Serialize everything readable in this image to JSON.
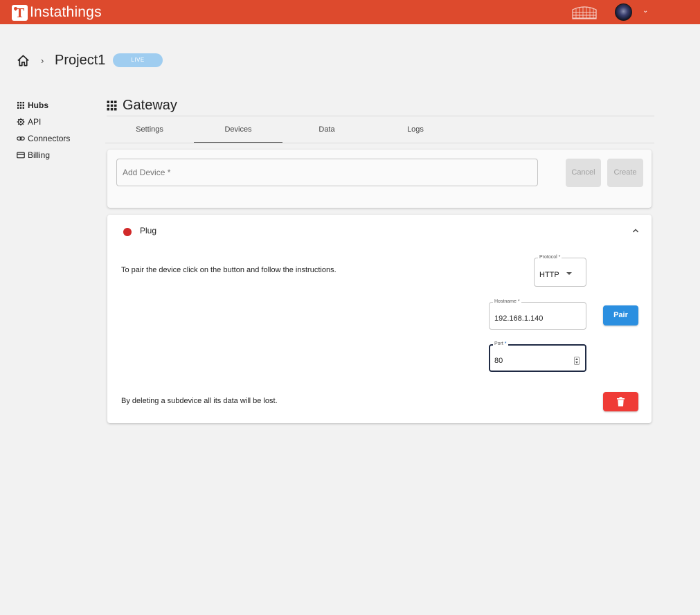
{
  "app": {
    "name": "Instathings",
    "logo_letter": "T"
  },
  "header": {
    "logo_icon": "instathings-logo-icon",
    "partner_icon": "colosseum-icon",
    "avatar_icon": "user-avatar",
    "menu_icon": "chevron-down-icon"
  },
  "breadcrumb": {
    "home_icon": "home-icon",
    "separator": "›",
    "project": "Project1",
    "badge": "LIVE"
  },
  "sidebar": {
    "items": [
      {
        "label": "Hubs",
        "icon": "grid-icon",
        "active": true
      },
      {
        "label": "API",
        "icon": "gear-icon",
        "active": false
      },
      {
        "label": "Connectors",
        "icon": "link-icon",
        "active": false
      },
      {
        "label": "Billing",
        "icon": "card-icon",
        "active": false
      }
    ]
  },
  "section": {
    "title": "Gateway",
    "icon": "grid-icon"
  },
  "tabs": [
    {
      "label": "Settings",
      "active": false
    },
    {
      "label": "Devices",
      "active": true
    },
    {
      "label": "Data",
      "active": false
    },
    {
      "label": "Logs",
      "active": false
    }
  ],
  "add_device": {
    "placeholder": "Add Device *",
    "cancel_label": "Cancel",
    "create_label": "Create"
  },
  "device": {
    "name": "Plug",
    "status_color": "#d12a2a",
    "pair_instructions": "To pair the device click on the button and follow the instructions.",
    "protocol": {
      "label": "Protocol *",
      "value": "HTTP"
    },
    "hostname": {
      "label": "Hostname *",
      "value": "192.168.1.140"
    },
    "port": {
      "label": "Port",
      "required_mark": "*",
      "value": "80"
    },
    "pair_label": "Pair",
    "delete_warning": "By deleting a subdevice all its data will be lost."
  },
  "colors": {
    "brand": "#dd4a2d",
    "primary": "#2b8fe0",
    "danger": "#ef3b36",
    "badge": "#9fcdf0"
  }
}
